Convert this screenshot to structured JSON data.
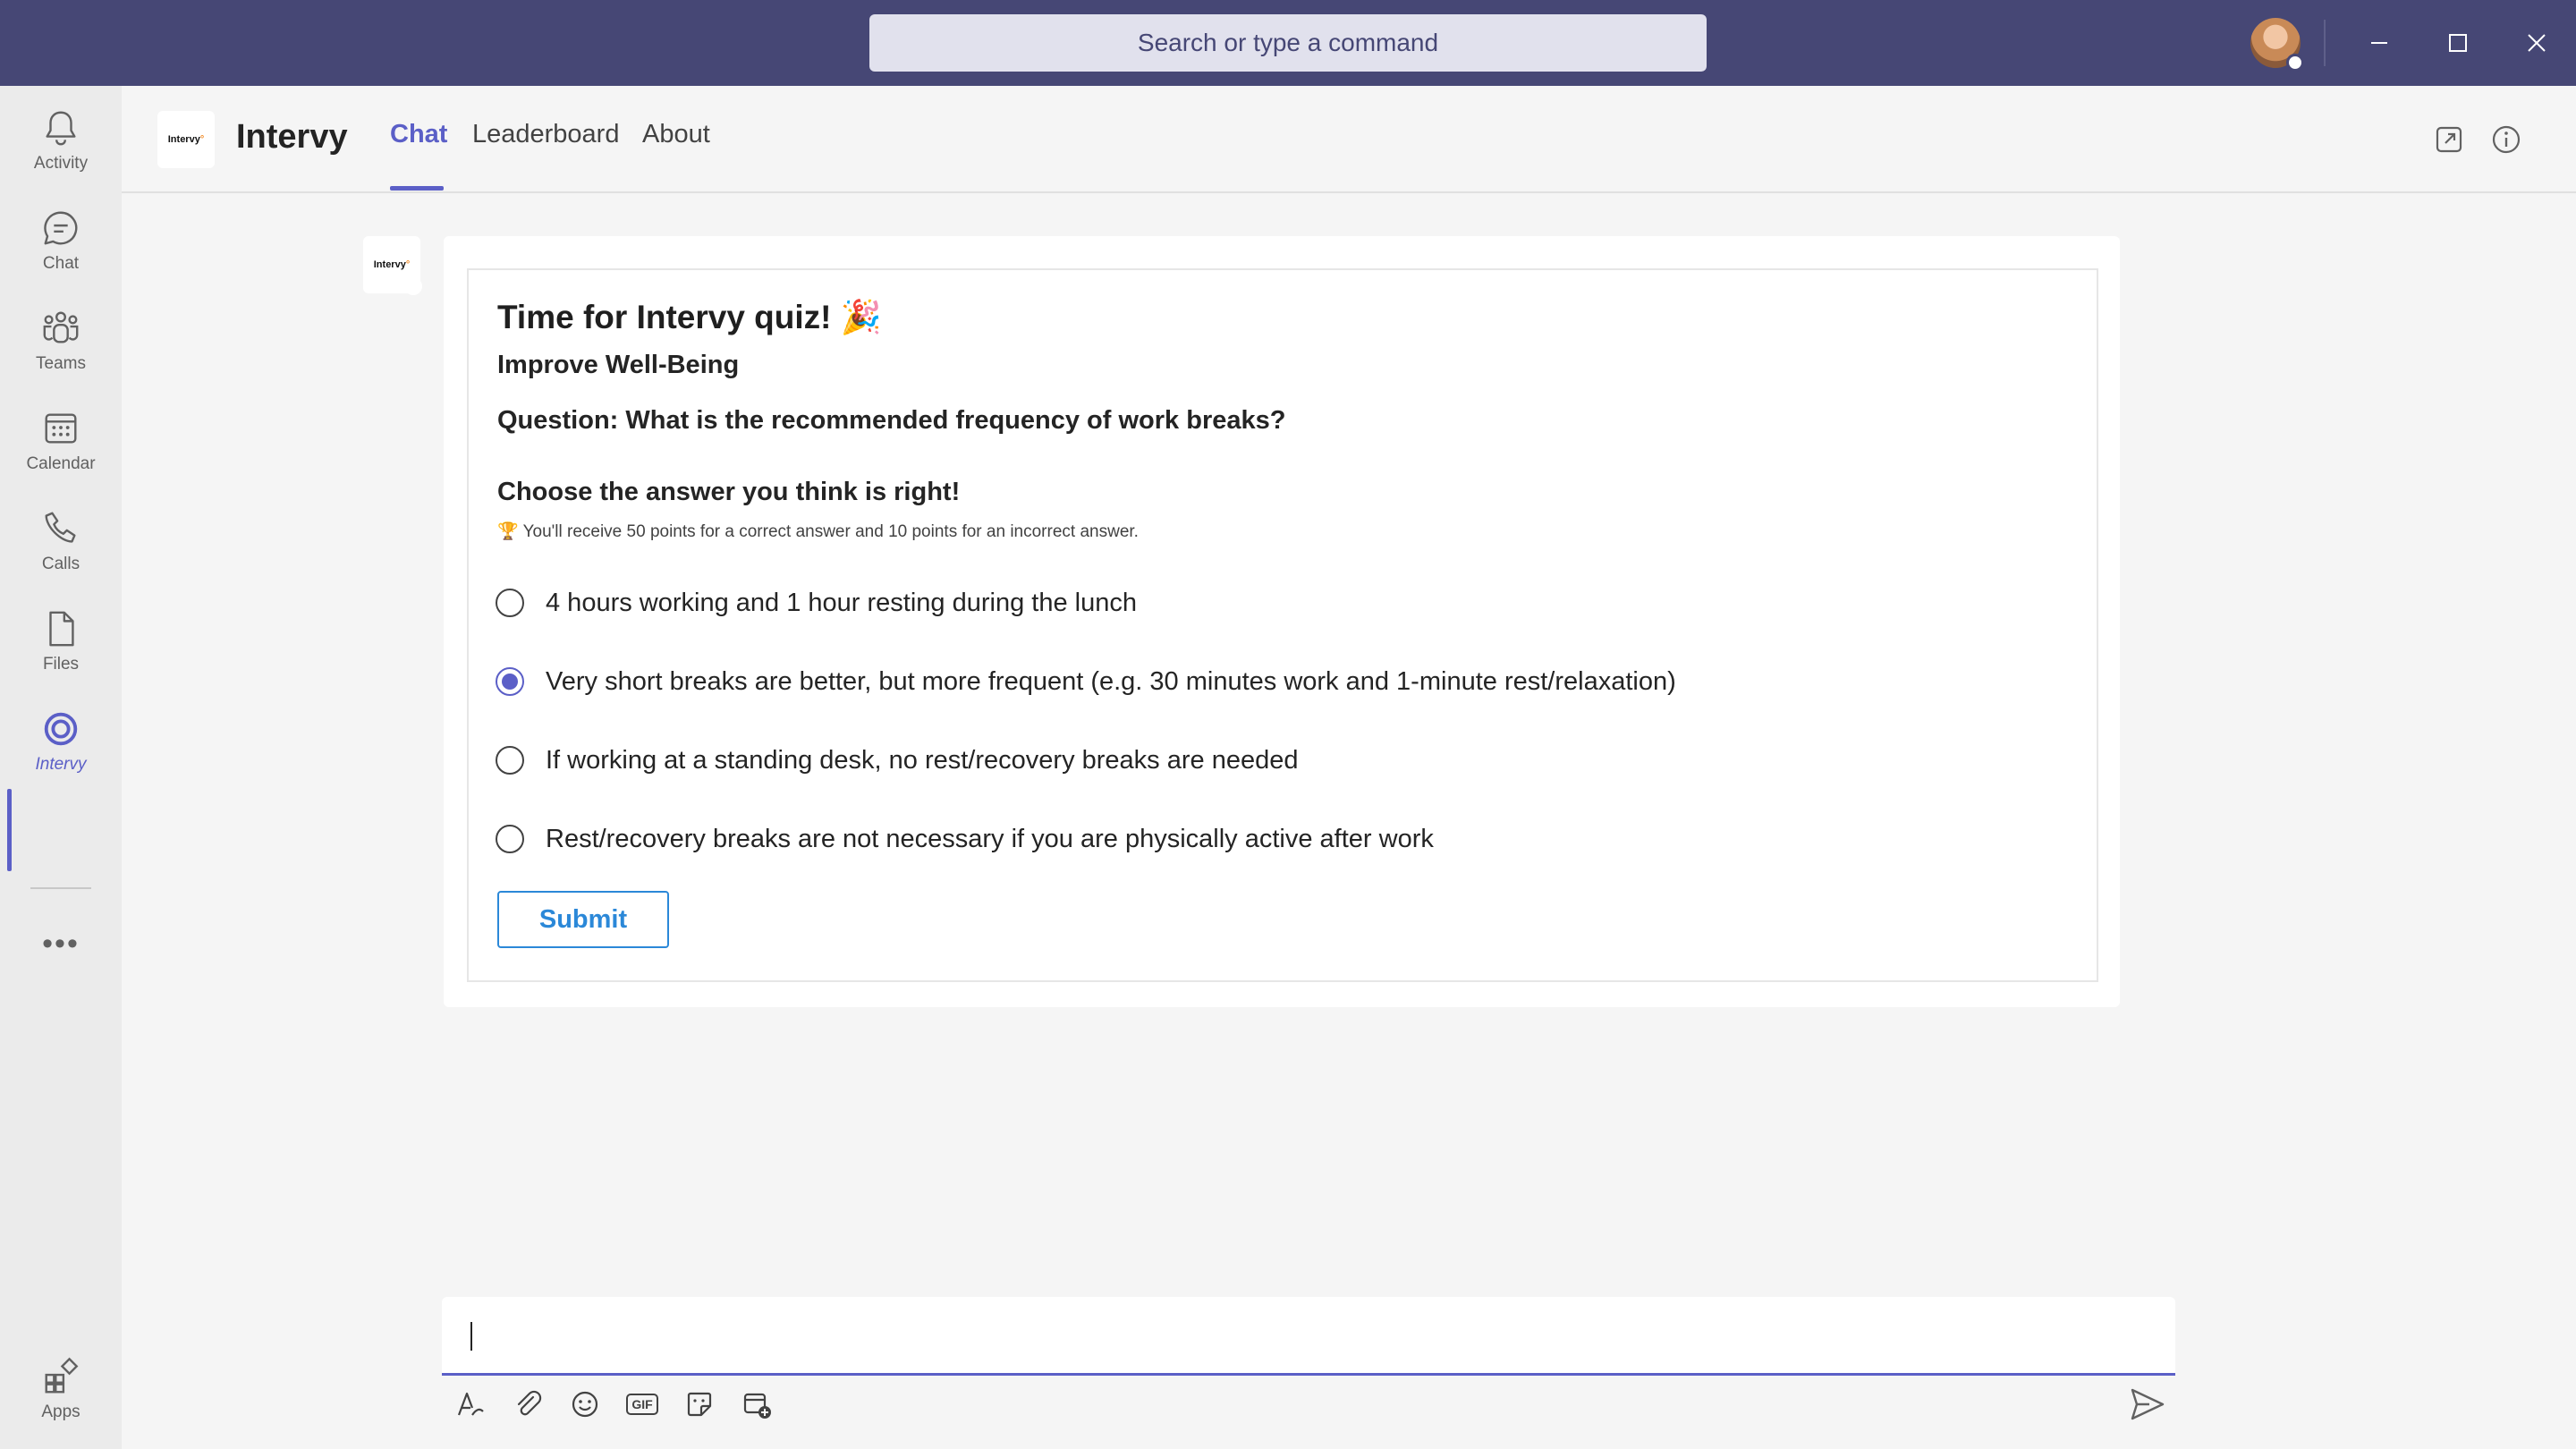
{
  "titlebar": {
    "search_placeholder": "Search or type a command"
  },
  "rail": {
    "items": [
      {
        "label": "Activity",
        "icon": "bell-icon"
      },
      {
        "label": "Chat",
        "icon": "chat-icon"
      },
      {
        "label": "Teams",
        "icon": "teams-icon"
      },
      {
        "label": "Calendar",
        "icon": "calendar-icon"
      },
      {
        "label": "Calls",
        "icon": "phone-icon"
      },
      {
        "label": "Files",
        "icon": "file-icon"
      },
      {
        "label": "Intervy",
        "icon": "intervy-icon"
      }
    ],
    "more": "•••",
    "apps_label": "Apps"
  },
  "app": {
    "logo_text": "Intervy",
    "name": "Intervy",
    "tabs": [
      "Chat",
      "Leaderboard",
      "About"
    ],
    "active_tab": "Chat"
  },
  "card": {
    "title": "Time for Intervy quiz! 🎉",
    "subtitle": "Improve Well-Being",
    "question": "Question: What is the recommended frequency of work breaks?",
    "choose": "Choose the answer you think is right!",
    "note": "🏆 You'll receive 50 points for a correct answer and 10 points for an incorrect answer.",
    "options": [
      {
        "label": "4 hours working and 1 hour resting during the lunch",
        "selected": false
      },
      {
        "label": "Very short breaks are better, but more frequent (e.g. 30 minutes work and 1-minute rest/relaxation)",
        "selected": true
      },
      {
        "label": "If working at a standing desk, no rest/recovery breaks are needed",
        "selected": false
      },
      {
        "label": "Rest/recovery breaks are not necessary if you are physically active after work",
        "selected": false
      }
    ],
    "submit_label": "Submit"
  },
  "compose": {
    "value": "",
    "gif_label": "GIF"
  },
  "colors": {
    "titlebar": "#464775",
    "accent": "#5b5fc7",
    "submit": "#2b88d8"
  }
}
